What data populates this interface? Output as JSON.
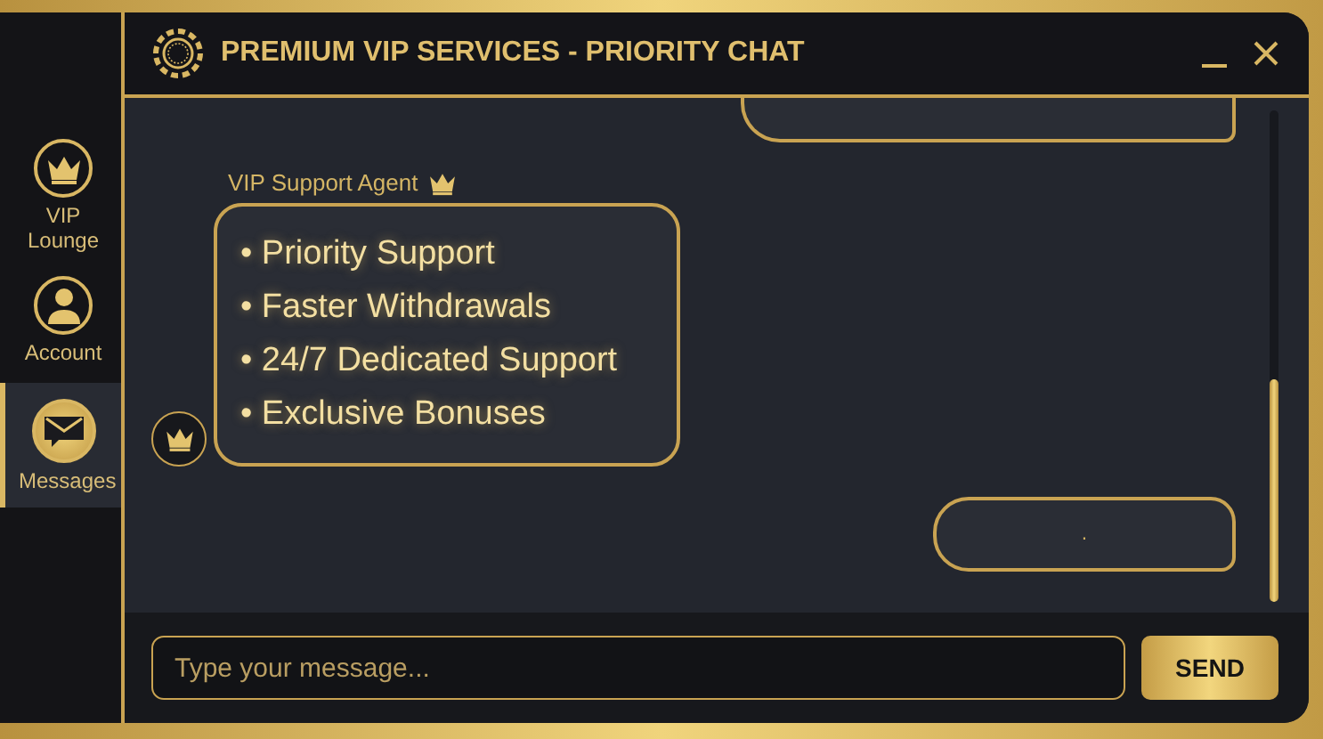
{
  "window": {
    "title": "PREMIUM VIP SERVICES - PRIORITY CHAT"
  },
  "sidebar": {
    "items": [
      {
        "label": "VIP Lounge",
        "kind": "crown",
        "selected": false
      },
      {
        "label": "Account",
        "kind": "person",
        "selected": false
      },
      {
        "label": "Messages",
        "kind": "envelope",
        "selected": true
      }
    ]
  },
  "chat": {
    "messages": [
      {
        "kind": "partial"
      },
      {
        "kind": "agent",
        "sender": "VIP Support Agent",
        "bullets": [
          "• Priority Support",
          "• Faster Withdrawals",
          "• 24/7 Dedicated Support",
          "• Exclusive Bonuses"
        ]
      },
      {
        "kind": "user",
        "text": "."
      }
    ]
  },
  "composer": {
    "placeholder": "Type your message...",
    "button": "SEND"
  }
}
